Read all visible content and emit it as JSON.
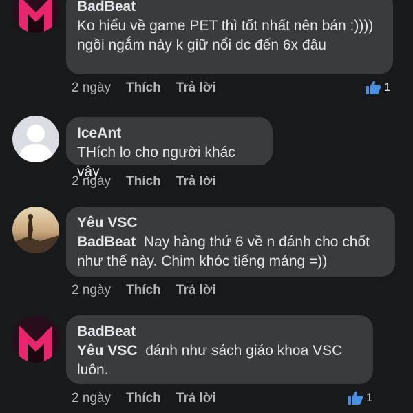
{
  "comments": [
    {
      "author": "BadBeat",
      "text": "Ko hiểu về game PET thì tốt nhất nên bán :)))) ngồi ngắm này k giữ nổi dc đến 6x đâu",
      "time": "2 ngày",
      "like_label": "Thích",
      "reply_label": "Trả lời",
      "reactions": "1"
    },
    {
      "author": "IceAnt",
      "text": "THích lo cho người khác vậy",
      "time": "2 ngày",
      "like_label": "Thích",
      "reply_label": "Trả lời"
    },
    {
      "author": "Yêu VSC",
      "mention": "BadBeat",
      "text": "Nay hàng thứ 6 về n đánh cho chốt như thế này. Chim khóc tiếng máng =))",
      "time": "2 ngày",
      "like_label": "Thích",
      "reply_label": "Trả lời"
    },
    {
      "author": "BadBeat",
      "mention": "Yêu VSC",
      "text": "đánh như sách giáo khoa VSC luôn.",
      "time": "2 ngày",
      "like_label": "Thích",
      "reply_label": "Trả lời",
      "reactions": "1"
    }
  ],
  "colors": {
    "background": "#18191a",
    "bubble": "#3a3b3c",
    "secondary_text": "#b0b3b8",
    "like_blue": "#1877f2"
  }
}
